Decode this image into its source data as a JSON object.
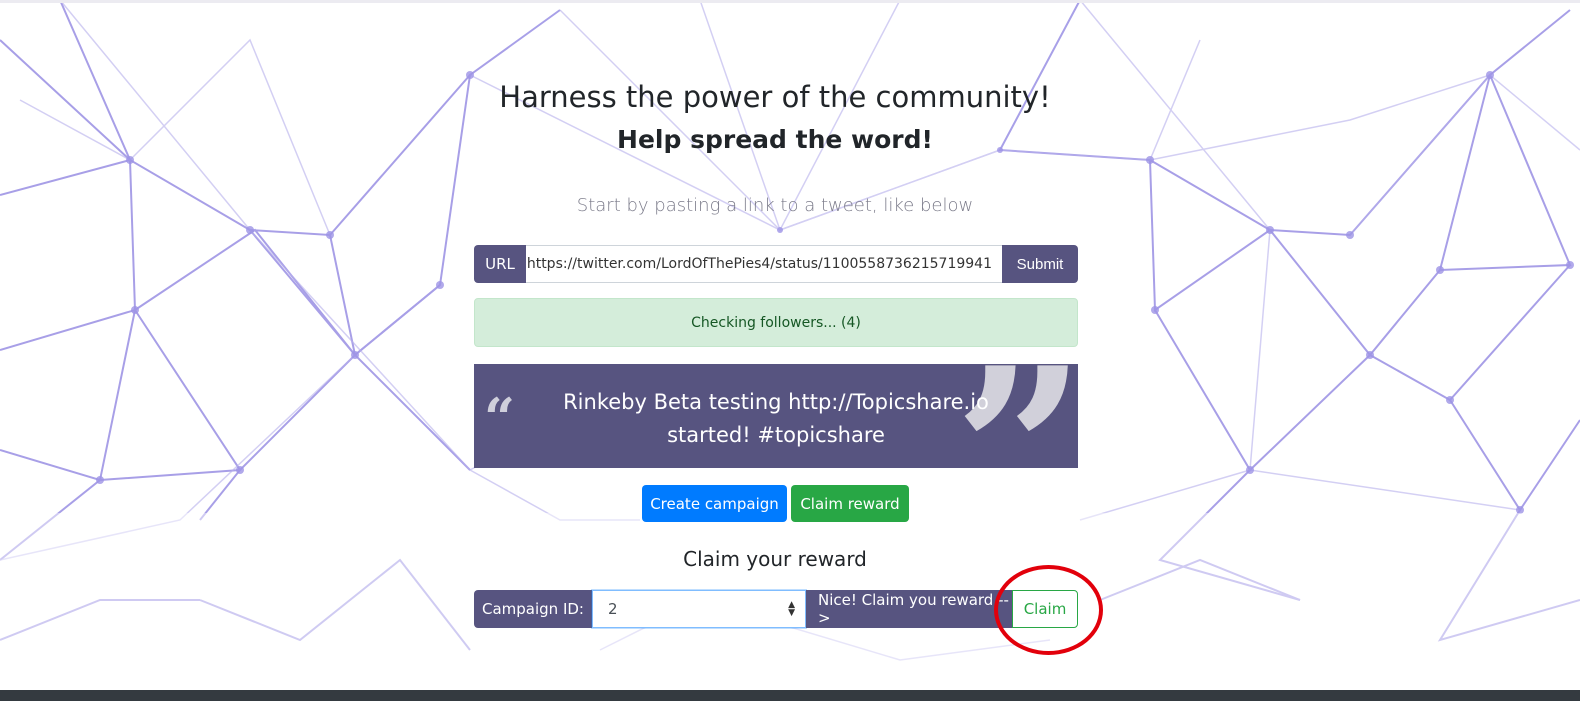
{
  "header": {
    "title": "Harness the power of the community!",
    "subtitle": "Help spread the word!",
    "lead": "Start by pasting a link to a tweet, like below"
  },
  "url_form": {
    "label": "URL",
    "value": "https://twitter.com/LordOfThePies4/status/1100558736215719941",
    "submit_label": "Submit"
  },
  "status": {
    "text": "Checking followers... (4)"
  },
  "tweet": {
    "text": "Rinkeby Beta testing http://Topicshare.io started! #topicshare",
    "open_quote": "“",
    "close_quote": "”"
  },
  "actions": {
    "create_label": "Create campaign",
    "claim_label": "Claim reward"
  },
  "claim_section": {
    "title": "Claim your reward",
    "campaign_label": "Campaign ID:",
    "campaign_value": "2",
    "nice_label": "Nice! Claim you reward -->",
    "claim_button": "Claim"
  },
  "colors": {
    "addon_bg": "#575480",
    "primary": "#007bff",
    "success": "#28a745",
    "alert_bg": "#d4edda",
    "highlight": "#e2000b"
  }
}
